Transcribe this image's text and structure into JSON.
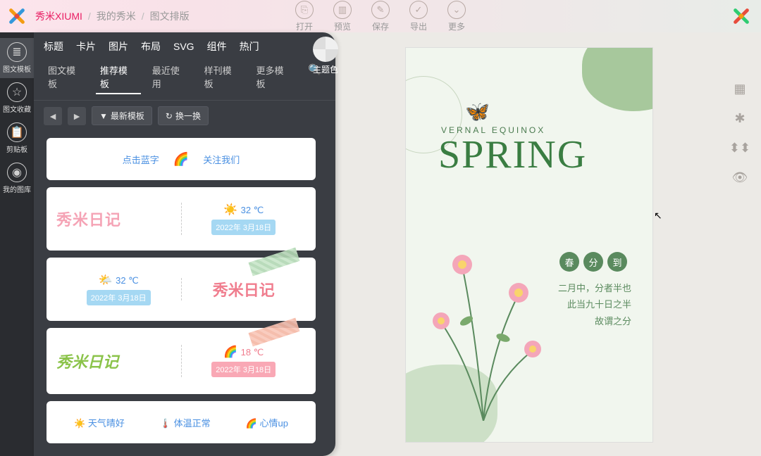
{
  "header": {
    "brand": "秀米XIUMI",
    "crumb1": "我的秀米",
    "crumb2": "图文排版",
    "actions": {
      "open": "打开",
      "preview": "预览",
      "save": "保存",
      "export": "导出",
      "more": "更多"
    }
  },
  "rail": {
    "item0": "图文模板",
    "item1": "图文收藏",
    "item2": "剪贴板",
    "item3": "我的图库"
  },
  "panel": {
    "tabs": {
      "t0": "标题",
      "t1": "卡片",
      "t2": "图片",
      "t3": "布局",
      "t4": "SVG",
      "t5": "组件",
      "t6": "热门"
    },
    "theme": "主题色",
    "subtabs": {
      "s0": "图文模板",
      "s1": "推荐模板",
      "s2": "最近使用",
      "s3": "样刊模板",
      "s4": "更多模板"
    },
    "toolbar": {
      "latest": "最新模板",
      "shuffle": "换一换"
    }
  },
  "cards": {
    "c1a": "点击蓝字",
    "c1b": "关注我们",
    "c2title": "秀米日记",
    "c2temp": "32 ℃",
    "c2date": "2022年 3月18日",
    "c3temp": "32 ℃",
    "c3date": "2022年 3月18日",
    "c3title": "秀米日记",
    "c4title": "秀米日记",
    "c4temp": "18 ℃",
    "c4date": "2022年 3月18日",
    "c5a": "天气晴好",
    "c5b": "体温正常",
    "c5c": "心情up"
  },
  "canvas": {
    "subtitle": "VERNAL EQUINOX",
    "title": "SPRING",
    "badge": {
      "b0": "春",
      "b1": "分",
      "b2": "到"
    },
    "poem1": "二月中，分者半也",
    "poem2": "此当九十日之半",
    "poem3": "故谓之分"
  }
}
